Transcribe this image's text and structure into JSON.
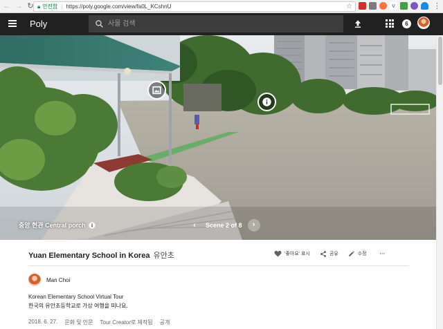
{
  "browser": {
    "security_label": "안전함",
    "url": "https://poly.google.com/view/fa0L_KCshnU"
  },
  "header": {
    "logo": "Poly",
    "search_placeholder": "사물 검색",
    "notification_count": "6"
  },
  "scene": {
    "caption": "중앙 현관 Central porch",
    "nav_label": "Scene 2 of 8"
  },
  "details": {
    "title_en": "Yuan Elementary School in Korea",
    "title_ko": "유안초",
    "actions": {
      "like_label": "'좋아요' 표시",
      "share_label": "공유",
      "edit_label": "수정",
      "more_label": "···"
    },
    "author": "Man Choi",
    "description_line1": "Korean Elementary School Virtual Tour",
    "description_line2": "한국의 유안초등학교로 가상 여행을 떠나요.",
    "meta": {
      "date": "2018. 6. 27.",
      "category": "문화 및 인문",
      "tool": "Tour Creator로 제작됨",
      "visibility": "공개"
    }
  },
  "colors": {
    "app_bar": "#212121",
    "search_bg": "#3d3d3d",
    "secure_green": "#0b8043"
  }
}
